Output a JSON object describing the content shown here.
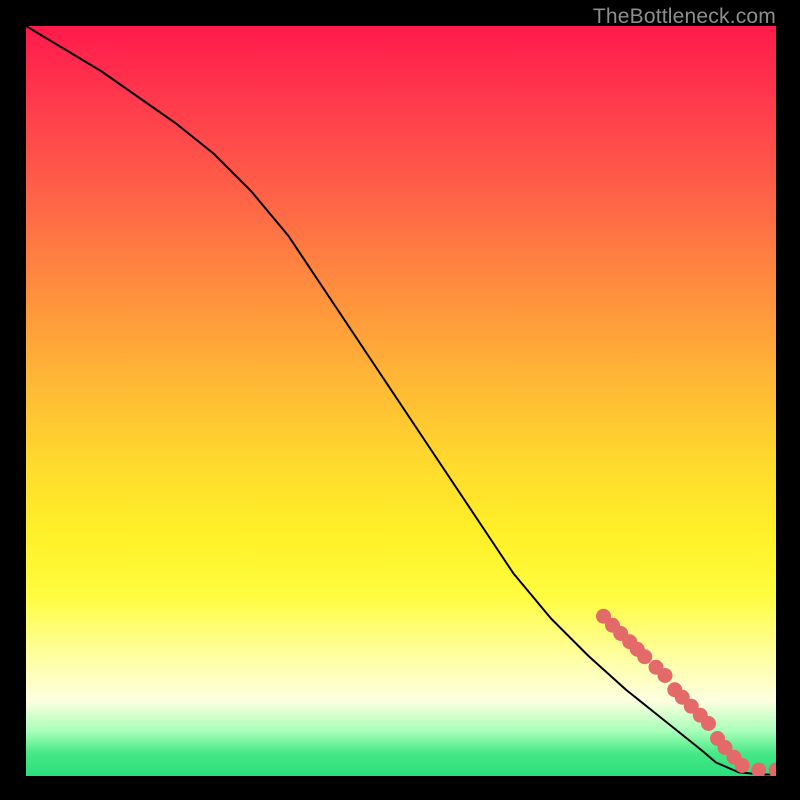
{
  "watermark": "TheBottleneck.com",
  "colors": {
    "line": "#000000",
    "marker": "#e46a6a",
    "marker_stroke": "#bb4e4e"
  },
  "chart_data": {
    "type": "line",
    "title": "",
    "xlabel": "",
    "ylabel": "",
    "xlim": [
      0,
      100
    ],
    "ylim": [
      0,
      100
    ],
    "grid": false,
    "legend": false,
    "series": [
      {
        "name": "curve",
        "x": [
          0,
          5,
          10,
          15,
          20,
          25,
          30,
          35,
          40,
          45,
          50,
          55,
          60,
          65,
          70,
          75,
          80,
          85,
          90,
          92,
          95,
          98,
          100
        ],
        "y": [
          100,
          97.0,
          94.0,
          90.5,
          87.0,
          83.0,
          78.0,
          72.0,
          64.5,
          57.0,
          49.5,
          42.0,
          34.5,
          27.0,
          21.0,
          16.0,
          11.5,
          7.5,
          3.5,
          1.8,
          0.5,
          0.2,
          0.2
        ]
      }
    ],
    "markers": {
      "name": "highlighted-points",
      "color": "#e46a6a",
      "points": [
        {
          "x": 77.0,
          "y": 21.3
        },
        {
          "x": 78.2,
          "y": 20.1
        },
        {
          "x": 79.3,
          "y": 19.0
        },
        {
          "x": 80.5,
          "y": 17.9
        },
        {
          "x": 81.5,
          "y": 16.9
        },
        {
          "x": 82.5,
          "y": 15.9
        },
        {
          "x": 84.0,
          "y": 14.5
        },
        {
          "x": 85.2,
          "y": 13.4
        },
        {
          "x": 86.5,
          "y": 11.5
        },
        {
          "x": 87.5,
          "y": 10.5
        },
        {
          "x": 88.7,
          "y": 9.3
        },
        {
          "x": 89.9,
          "y": 8.1
        },
        {
          "x": 91.0,
          "y": 7.0
        },
        {
          "x": 92.2,
          "y": 5.0
        },
        {
          "x": 93.2,
          "y": 3.8
        },
        {
          "x": 94.4,
          "y": 2.5
        },
        {
          "x": 95.5,
          "y": 1.4
        },
        {
          "x": 97.7,
          "y": 0.8
        },
        {
          "x": 100.0,
          "y": 0.8
        }
      ]
    }
  }
}
